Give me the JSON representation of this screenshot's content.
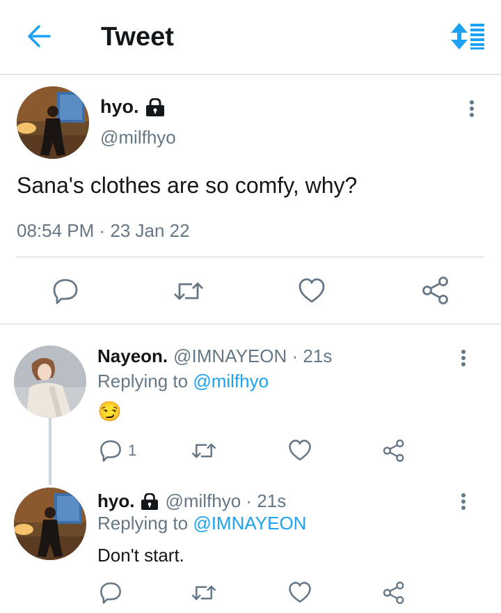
{
  "header": {
    "title": "Tweet",
    "back_icon": "arrow-left-icon",
    "sort_icon": "sort-icon",
    "accent": "#1da1f2"
  },
  "main_tweet": {
    "name": "hyo.",
    "handle": "@milfhyo",
    "text": "Sana's clothes are so comfy, why?",
    "timestamp": "08:54 PM · 23 Jan 22",
    "protected": true
  },
  "replies": [
    {
      "name": "Nayeon.",
      "meta": "@IMNAYEON · 21s",
      "replying_label": "Replying to",
      "replying_to": "@milfhyo",
      "text": "😏",
      "reply_count": "1",
      "protected": false
    },
    {
      "name": "hyo.",
      "meta": "@milfhyo · 21s",
      "replying_label": "Replying to",
      "replying_to": "@IMNAYEON",
      "text": "Don't start.",
      "reply_count": "",
      "protected": true
    }
  ]
}
